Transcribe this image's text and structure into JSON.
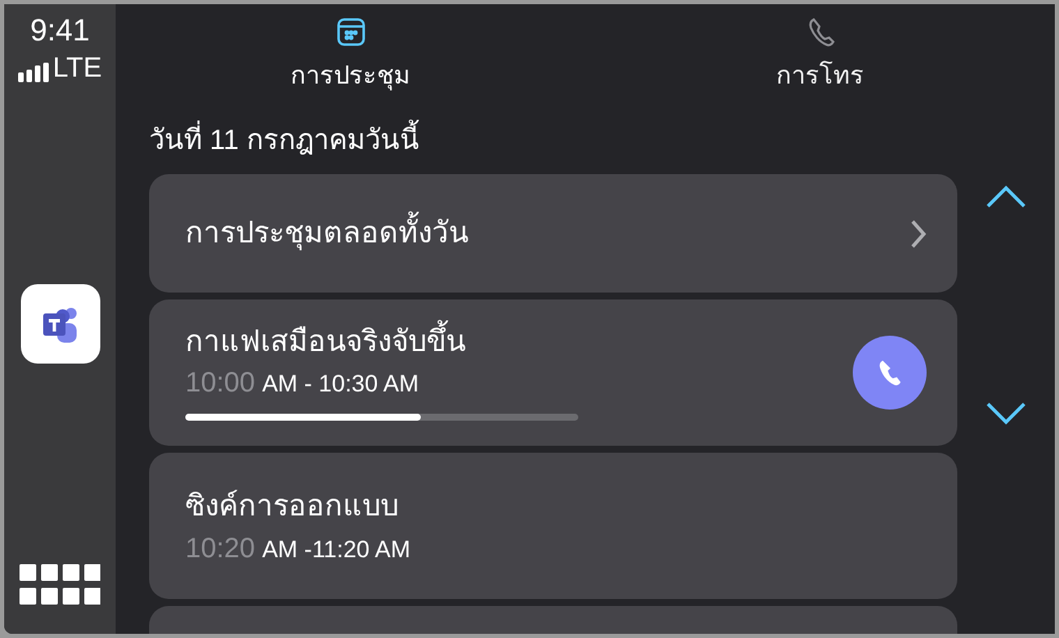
{
  "status": {
    "time": "9:41",
    "network": "LTE"
  },
  "tabs": [
    {
      "label": "การประชุม",
      "kind": "calendar",
      "selected": true
    },
    {
      "label": "การโทร",
      "kind": "phone",
      "selected": false
    }
  ],
  "date_heading": "วันที่ 11 กรกฎาคมวันนี้",
  "events": [
    {
      "kind": "all_day",
      "title": "การประชุมตลอดทั้งวัน"
    },
    {
      "kind": "meeting",
      "title": "กาแฟเสมือนจริงจับขึ้น",
      "time_start": "10:00",
      "time_rest": "AM - 10:30 AM",
      "level": 0.6,
      "call": true
    },
    {
      "kind": "meeting",
      "title": "ซิงค์การออกแบบ",
      "time_start": "10:20",
      "time_rest": "AM -11:20 AM",
      "call": false
    },
    {
      "kind": "empty"
    }
  ]
}
